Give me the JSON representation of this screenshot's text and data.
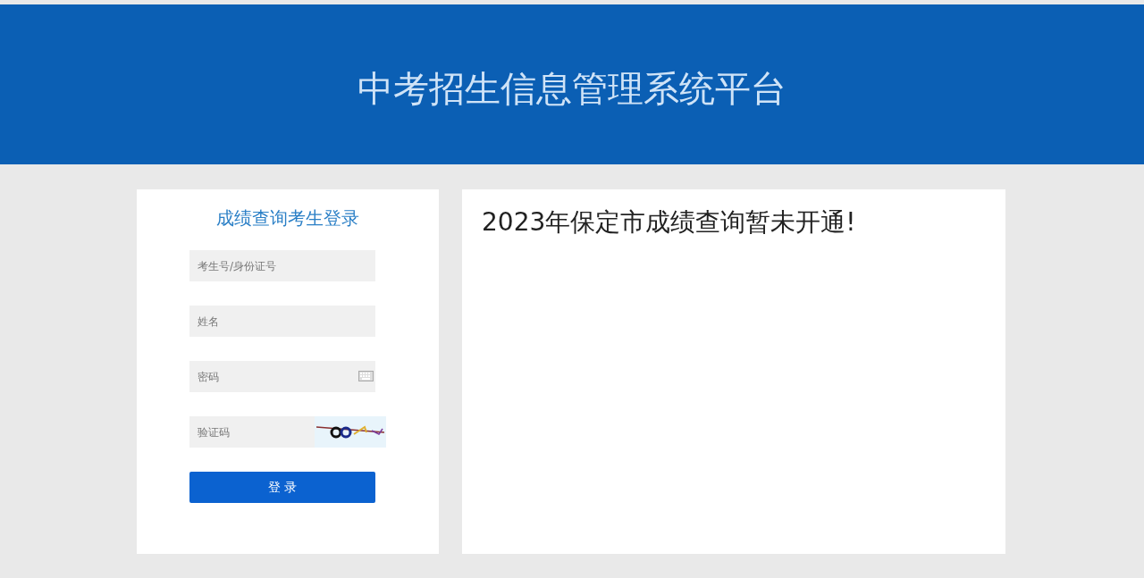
{
  "header": {
    "title": "中考招生信息管理系统平台"
  },
  "login": {
    "title": "成绩查询考生登录",
    "fields": [
      {
        "kind": "text",
        "placeholder": "考生号/身份证号"
      },
      {
        "kind": "text",
        "placeholder": "姓名"
      },
      {
        "kind": "password",
        "placeholder": "密码"
      },
      {
        "kind": "captcha",
        "placeholder": "验证码"
      }
    ],
    "button": "登 录"
  },
  "notice": {
    "message": "2023年保定市成绩查询暂未开通!"
  }
}
